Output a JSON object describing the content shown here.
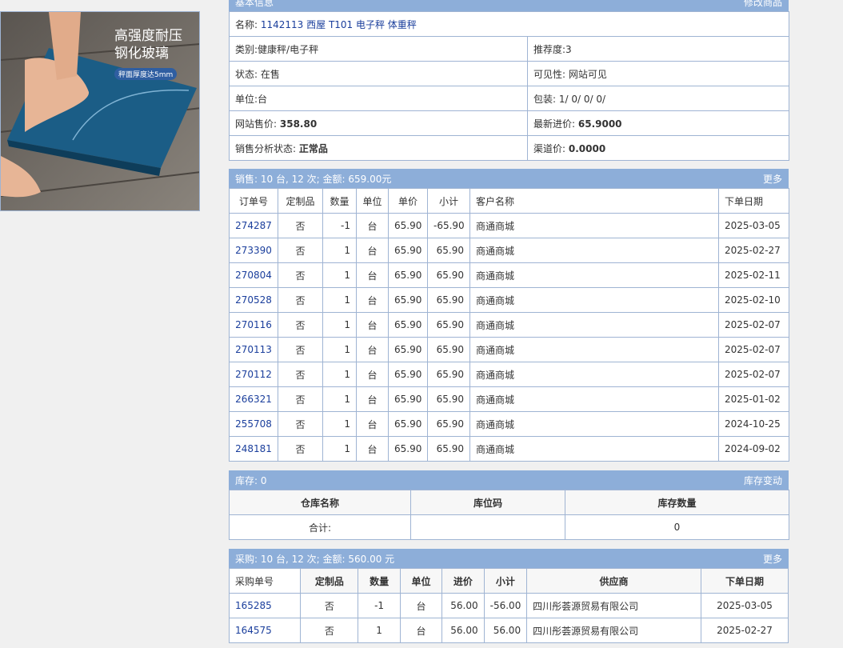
{
  "basic": {
    "header_title": "基本信息",
    "edit_link": "修改商品",
    "name_label": "名称:",
    "name_value": "1142113 西屋 T101 电子秤 体重秤",
    "category_label": "类别:",
    "category_value": "健康秤/电子秤",
    "recommend_label": "推荐度:",
    "recommend_value": "3",
    "status_label": "状态:",
    "status_value": "在售",
    "visibility_label": "可见性:",
    "visibility_value": "网站可见",
    "unit_label": "单位:",
    "unit_value": "台",
    "packing_label": "包装:",
    "packing_value": "1/ 0/ 0/ 0/",
    "price_label": "网站售价:",
    "price_value": "358.80",
    "latest_cost_label": "最新进价:",
    "latest_cost_value": "65.9000",
    "sales_status_label": "销售分析状态:",
    "sales_status_value": "正常品",
    "channel_price_label": "渠道价:",
    "channel_price_value": "0.0000"
  },
  "product_image": {
    "line1": "高强度耐压",
    "line2": "钢化玻璃",
    "badge": "秤面厚度达5mm"
  },
  "sales": {
    "header": "销售: 10 台, 12 次; 金额: 659.00元",
    "more": "更多",
    "columns": [
      "订单号",
      "定制品",
      "数量",
      "单位",
      "单价",
      "小计",
      "客户名称",
      "下单日期"
    ],
    "rows": [
      [
        "274287",
        "否",
        "-1",
        "台",
        "65.90",
        "-65.90",
        "商通商城",
        "2025-03-05"
      ],
      [
        "273390",
        "否",
        "1",
        "台",
        "65.90",
        "65.90",
        "商通商城",
        "2025-02-27"
      ],
      [
        "270804",
        "否",
        "1",
        "台",
        "65.90",
        "65.90",
        "商通商城",
        "2025-02-11"
      ],
      [
        "270528",
        "否",
        "1",
        "台",
        "65.90",
        "65.90",
        "商通商城",
        "2025-02-10"
      ],
      [
        "270116",
        "否",
        "1",
        "台",
        "65.90",
        "65.90",
        "商通商城",
        "2025-02-07"
      ],
      [
        "270113",
        "否",
        "1",
        "台",
        "65.90",
        "65.90",
        "商通商城",
        "2025-02-07"
      ],
      [
        "270112",
        "否",
        "1",
        "台",
        "65.90",
        "65.90",
        "商通商城",
        "2025-02-07"
      ],
      [
        "266321",
        "否",
        "1",
        "台",
        "65.90",
        "65.90",
        "商通商城",
        "2025-01-02"
      ],
      [
        "255708",
        "否",
        "1",
        "台",
        "65.90",
        "65.90",
        "商通商城",
        "2024-10-25"
      ],
      [
        "248181",
        "否",
        "1",
        "台",
        "65.90",
        "65.90",
        "商通商城",
        "2024-09-02"
      ]
    ]
  },
  "stock": {
    "header": "库存: 0",
    "link": "库存变动",
    "columns": [
      "仓库名称",
      "库位码",
      "库存数量"
    ],
    "total_label": "合计:",
    "total_location": "",
    "total_qty": "0"
  },
  "purchase": {
    "header": "采购: 10 台, 12 次; 金额: 560.00 元",
    "more": "更多",
    "columns": [
      "采购单号",
      "定制品",
      "数量",
      "单位",
      "进价",
      "小计",
      "供应商",
      "下单日期"
    ],
    "rows": [
      [
        "165285",
        "否",
        "-1",
        "台",
        "56.00",
        "-56.00",
        "四川彤荟源贸易有限公司",
        "2025-03-05"
      ],
      [
        "164575",
        "否",
        "1",
        "台",
        "56.00",
        "56.00",
        "四川彤荟源贸易有限公司",
        "2025-02-27"
      ]
    ]
  }
}
